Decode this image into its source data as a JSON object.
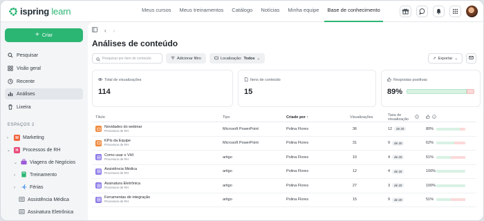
{
  "app": {
    "logo_text": "ispring",
    "logo_suffix": " learn"
  },
  "nav": [
    "Meus cursos",
    "Meus treinamentos",
    "Catálogo",
    "Notícias",
    "Minha equipe",
    "Base de conhecimento"
  ],
  "nav_active": "Base de conhecimento",
  "top_icons": [
    "gift-icon",
    "chat-icon",
    "bell-icon",
    "apps-grid-icon"
  ],
  "sidebar": {
    "create_label": "Criar",
    "items": [
      {
        "label": "Pesquisar",
        "icon": "search-icon"
      },
      {
        "label": "Visão geral",
        "icon": "grid-icon"
      },
      {
        "label": "Recente",
        "icon": "clock-icon"
      },
      {
        "label": "Análises",
        "icon": "bar-chart-icon",
        "active": true
      },
      {
        "label": "Lixeira",
        "icon": "trash-icon"
      }
    ],
    "spaces_label": "ESPAÇOS  2",
    "tree": [
      {
        "label": "Marketing",
        "badge": "M",
        "badge_color": "#f0643c"
      },
      {
        "label": "Processos de RH",
        "badge": "H",
        "badge_color": "#e84d7a"
      },
      {
        "label": "Viagens de Negócios",
        "icon_color": "#9b59d6"
      },
      {
        "label": "Treinamento",
        "icon_color": "#2bb673"
      },
      {
        "label": "Férias",
        "icon_color": "#3c8ce6"
      },
      {
        "label": "Assistência Médica"
      },
      {
        "label": "Assinatura Eletrônica"
      }
    ]
  },
  "page": {
    "title": "Análises de conteúdo",
    "search_placeholder": "Pesquisar por item de conteúdo",
    "add_filter_label": "Adicionar filtro",
    "location_label": "Localização:",
    "location_value": "Todos",
    "export_label": "Exportar"
  },
  "stats": {
    "views_label": "Total de visualizações",
    "views_value": "114",
    "items_label": "Itens de conteúdo",
    "items_value": "15",
    "positive_label": "Respostas positivas",
    "positive_value": "89%",
    "positive_fraction": 0.89
  },
  "table": {
    "headers": {
      "title": "Título",
      "type": "Tipo",
      "created_by": "Criado por",
      "views": "Visualizações",
      "rate_line1": "Taxa de",
      "rate_line2": "visualização"
    },
    "rows": [
      {
        "title": "Novidades do webinar",
        "space": "Processos de RH",
        "type": "Microsoft PowerPoint",
        "created_by": "Polina Flores",
        "views": "36",
        "rate": "12",
        "rate_of": "de 20",
        "pct": "80%",
        "fraction": 0.8,
        "icon": "ppt"
      },
      {
        "title": "KPIs da Equipe",
        "space": "Processos de RH",
        "type": "Microsoft PowerPoint",
        "created_by": "Polina Flores",
        "views": "31",
        "rate": "9",
        "rate_of": "de 20",
        "pct": "62%",
        "fraction": 0.62,
        "icon": "ppt"
      },
      {
        "title": "Como usar o VHI",
        "space": "Processos de RH",
        "type": "artigo",
        "created_by": "Polina Flores",
        "views": "10",
        "rate": "4",
        "rate_of": "de 20",
        "pct": "51%",
        "fraction": 0.51,
        "icon": "article"
      },
      {
        "title": "Assistência Médica",
        "space": "Processos de RH",
        "type": "artigo",
        "created_by": "Polina Flores",
        "views": "12",
        "rate": "4",
        "rate_of": "de 20",
        "pct": "100%",
        "fraction": 1.0,
        "icon": "article"
      },
      {
        "title": "Assinatura Eletrônica",
        "space": "Processos de RH",
        "type": "artigo",
        "created_by": "Polina Flores",
        "views": "27",
        "rate": "3",
        "rate_of": "de 20",
        "pct": "100%",
        "fraction": 1.0,
        "icon": "article"
      },
      {
        "title": "Ferramentas de integração",
        "space": "Processos de RH",
        "type": "artigo",
        "created_by": "Polina Flores",
        "views": "15",
        "rate": "9",
        "rate_of": "de 20",
        "pct": "51%",
        "fraction": 0.51,
        "icon": "article"
      }
    ]
  },
  "colors": {
    "accent": "#2bb673",
    "positive": "#d8f2e4",
    "negative": "#fbd9d9",
    "ppt": "#f0883c",
    "article": "#8a7be8"
  }
}
